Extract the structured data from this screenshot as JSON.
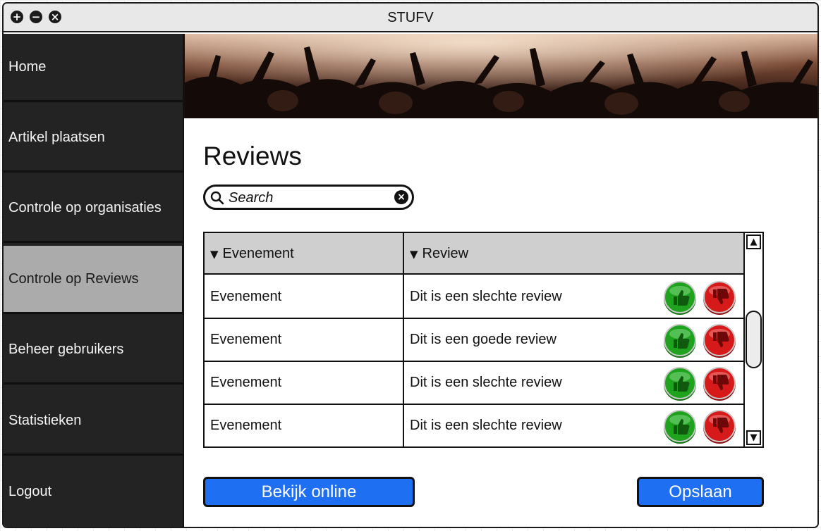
{
  "window": {
    "title": "STUFV"
  },
  "sidebar": {
    "items": [
      {
        "label": "Home"
      },
      {
        "label": "Artikel plaatsen"
      },
      {
        "label": "Controle op organisaties"
      },
      {
        "label": "Controle op Reviews",
        "active": true
      },
      {
        "label": "Beheer gebruikers"
      },
      {
        "label": "Statistieken"
      },
      {
        "label": "Logout"
      }
    ]
  },
  "banner": {
    "image": "concert-crowd-banner"
  },
  "main": {
    "title": "Reviews",
    "search": {
      "placeholder": "Search",
      "value": ""
    },
    "table": {
      "columns": [
        {
          "label": "Evenement"
        },
        {
          "label": "Review"
        }
      ],
      "rows": [
        {
          "event": "Evenement",
          "review": "Dit is een slechte review"
        },
        {
          "event": "Evenement",
          "review": "Dit is een goede review"
        },
        {
          "event": "Evenement",
          "review": "Dit is een slechte review"
        },
        {
          "event": "Evenement",
          "review": "Dit is een slechte review"
        }
      ]
    },
    "buttons": {
      "view_online": "Bekijk online",
      "save": "Opslaan"
    }
  },
  "icons": {
    "approve": "thumbs-up-icon",
    "reject": "thumbs-down-icon",
    "search": "search-icon",
    "clear": "clear-icon"
  },
  "colors": {
    "sidebar_bg": "#232323",
    "active_item_bg": "#ababab",
    "primary_button": "#1f6ff3",
    "approve": "#1fa31f",
    "reject": "#d61a1a",
    "table_header": "#cfcfcf"
  }
}
